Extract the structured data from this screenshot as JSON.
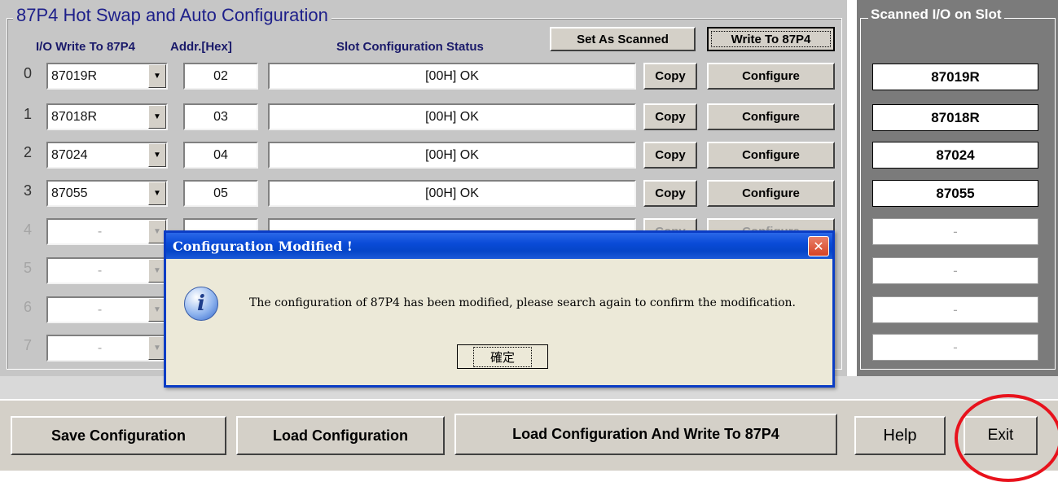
{
  "main_title": "87P4 Hot Swap and Auto Configuration",
  "right_title": "Scanned I/O on Slot",
  "headers": {
    "io_write": "I/O Write To 87P4",
    "addr": "Addr.[Hex]",
    "status": "Slot Configuration Status"
  },
  "top_buttons": {
    "set_as_scanned": "Set As Scanned",
    "write_to_87p4": "Write To 87P4"
  },
  "slots": [
    {
      "num": "0",
      "module": "87019R",
      "addr": "02",
      "status": "[00H] OK",
      "copy": "Copy",
      "configure": "Configure",
      "scanned": "87019R"
    },
    {
      "num": "1",
      "module": "87018R",
      "addr": "03",
      "status": "[00H] OK",
      "copy": "Copy",
      "configure": "Configure",
      "scanned": "87018R"
    },
    {
      "num": "2",
      "module": "87024",
      "addr": "04",
      "status": "[00H] OK",
      "copy": "Copy",
      "configure": "Configure",
      "scanned": "87024"
    },
    {
      "num": "3",
      "module": "87055",
      "addr": "05",
      "status": "[00H] OK",
      "copy": "Copy",
      "configure": "Configure",
      "scanned": "87055"
    },
    {
      "num": "4",
      "module": "-",
      "addr": "",
      "status": "",
      "copy": "Copy",
      "configure": "Configure",
      "scanned": "-"
    },
    {
      "num": "5",
      "module": "-",
      "addr": "",
      "status": "",
      "copy": "",
      "configure": "",
      "scanned": "-"
    },
    {
      "num": "6",
      "module": "-",
      "addr": "",
      "status": "",
      "copy": "",
      "configure": "",
      "scanned": "-"
    },
    {
      "num": "7",
      "module": "-",
      "addr": "",
      "status": "",
      "copy": "",
      "configure": "",
      "scanned": "-"
    }
  ],
  "dialog": {
    "title": "Configuration Modified !",
    "close": "✕",
    "message": "The configuration of 87P4 has been modified, please search again to confirm the modification.",
    "ok": "確定",
    "icon": "info-icon"
  },
  "bottom_buttons": {
    "save": "Save Configuration",
    "load": "Load Configuration",
    "load_write": "Load  Configuration And Write To 87P4",
    "help": "Help",
    "exit": "Exit"
  },
  "colors": {
    "title_blue": "#1d1f8a",
    "dialog_blue": "#0b3dc5",
    "highlight_red": "#e8121c"
  }
}
